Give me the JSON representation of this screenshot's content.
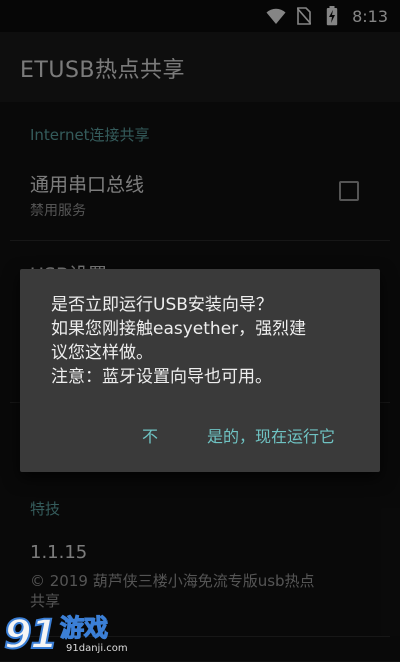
{
  "status_bar": {
    "time": "8:13",
    "icons": [
      "wifi-icon",
      "no-sim-icon",
      "battery-charging-icon"
    ]
  },
  "app_bar": {
    "title": "ETUSB热点共享"
  },
  "preferences": {
    "section_internet": "Internet连接共享",
    "serial_bus_title": "通用串口总线",
    "serial_bus_summary": "禁用服务",
    "serial_bus_checked": false,
    "usb_settings_title": "USB设置",
    "section_extra": "特技",
    "version_title": "1.1.15",
    "version_summary_line1": "© 2019 葫芦侠三楼小海免流专版usb热点",
    "version_summary_line2": "共享"
  },
  "dialog": {
    "line1": "是否立即运行USB安装向导？",
    "line2": "如果您刚接触easyether，强烈建",
    "line3": "议您这样做。",
    "line4": "注意：蓝牙设置向导也可用。",
    "negative_button": "不",
    "positive_button": "是的，现在运行它"
  },
  "watermark": {
    "brand": "91游戏",
    "url": "91danji.com"
  },
  "colors": {
    "accent": "#6fc3c3",
    "section_header": "#5fa6a6",
    "dialog_bg": "#3a3a3a",
    "background": "#121212"
  }
}
